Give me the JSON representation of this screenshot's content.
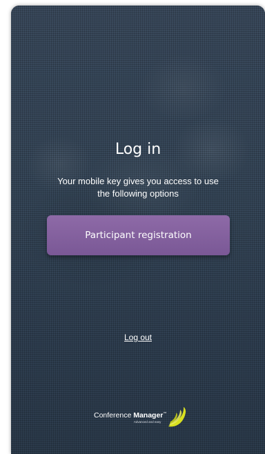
{
  "login": {
    "title": "Log in",
    "subtitle": "Your mobile key gives you access to use the following options",
    "participant_button": "Participant registration",
    "logout_link": "Log out"
  },
  "brand": {
    "name_light": "Conference",
    "name_bold": "Manager",
    "trademark": "™",
    "tagline": "Advanced and easy",
    "logo_icon": "yellow-leaf-swoosh-icon",
    "logo_color": "#d8e020"
  },
  "colors": {
    "background": "#334457",
    "button": "#85629f",
    "text": "#ffffff"
  }
}
